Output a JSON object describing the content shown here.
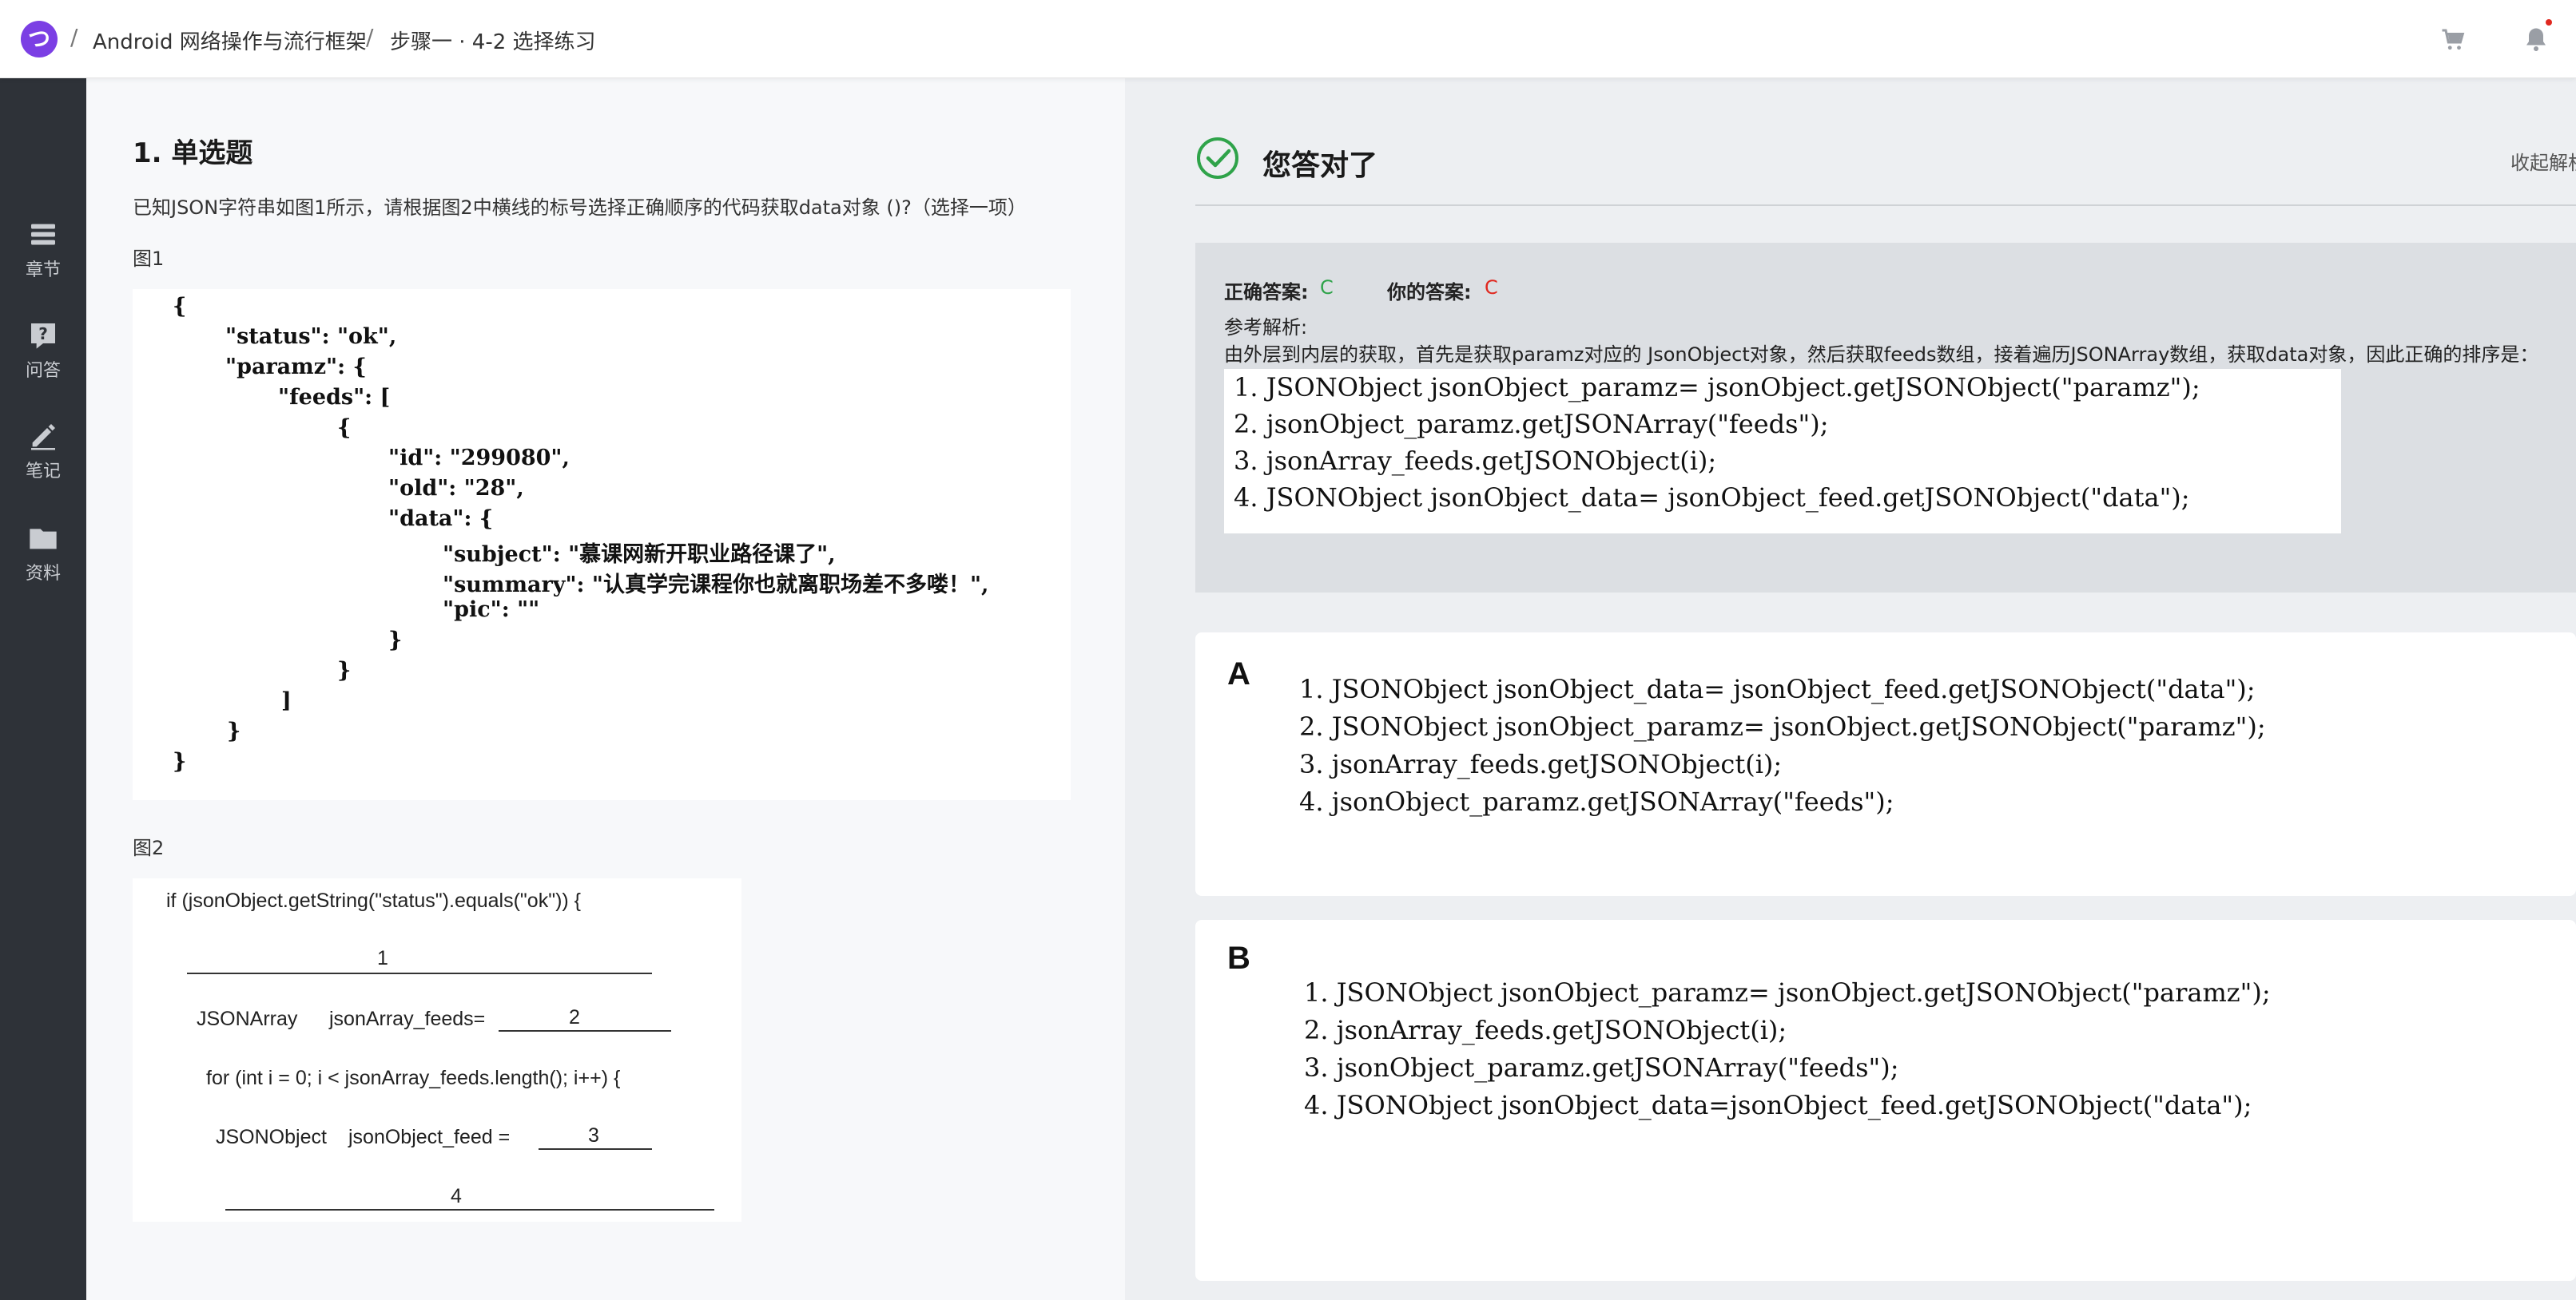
{
  "header": {
    "breadcrumb": [
      "Android 网络操作与流行框架",
      "步骤一 · 4-2 选择练习"
    ],
    "separator": "/"
  },
  "sidebar": {
    "items": [
      {
        "label": "章节",
        "icon": "layers-icon"
      },
      {
        "label": "问答",
        "icon": "question-icon"
      },
      {
        "label": "笔记",
        "icon": "pencil-icon"
      },
      {
        "label": "资料",
        "icon": "folder-icon"
      }
    ]
  },
  "question": {
    "title": "1. 单选题",
    "stem": "已知JSON字符串如图1所示，请根据图2中横线的标号选择正确顺序的代码获取data对象 ()?（选择一项）",
    "fig1_label": "图1",
    "fig2_label": "图2",
    "fig1_json_lines": [
      "{",
      "\"status\": \"ok\",",
      "\"paramz\": {",
      "\"feeds\": [",
      "{",
      "\"id\": \"299080\",",
      "\"old\": \"28\",",
      "\"data\": {",
      "\"subject\": \"慕课网新开职业路径课了\",",
      "\"summary\": \"认真学完课程你也就离职场差不多喽！\",",
      "\"pic\": \"\"",
      "}",
      "}",
      "]",
      "}",
      "}"
    ],
    "fig2_code": {
      "line1": "if (jsonObject.getString(\"status\").equals(\"ok\")) {",
      "blank1": "1",
      "line2a": "JSONArray",
      "line2b": "jsonArray_feeds=",
      "blank2": "2",
      "line3": "for (int i = 0; i < jsonArray_feeds.length(); i++) {",
      "line4a": "JSONObject",
      "line4b": "jsonObject_feed =",
      "blank3": "3",
      "blank4": "4"
    }
  },
  "result": {
    "title": "您答对了",
    "collapse_label": "收起解析",
    "correct_answer_label": "正确答案:",
    "correct_answer": "C",
    "your_answer_label": "你的答案:",
    "your_answer": "C",
    "reference_label": "参考解析:",
    "reference_text": "由外层到内层的获取，首先是获取paramz对应的 JsonObject对象，然后获取feeds数组，接着遍历JSONArray数组，获取data对象，因此正确的排序是：",
    "reference_code": [
      "1.  JSONObject jsonObject_paramz= jsonObject.getJSONObject(\"paramz\");",
      "2.  jsonObject_paramz.getJSONArray(\"feeds\");",
      "3.  jsonArray_feeds.getJSONObject(i);",
      "4.  JSONObject jsonObject_data= jsonObject_feed.getJSONObject(\"data\");"
    ],
    "correct_color": "#2fa34a",
    "wrong_color": "#e0281f"
  },
  "options": [
    {
      "letter": "A",
      "lines": [
        "1.  JSONObject jsonObject_data= jsonObject_feed.getJSONObject(\"data\");",
        "2.  JSONObject jsonObject_paramz= jsonObject.getJSONObject(\"paramz\");",
        "3.  jsonArray_feeds.getJSONObject(i);",
        "4.  jsonObject_paramz.getJSONArray(\"feeds\");"
      ]
    },
    {
      "letter": "B",
      "lines": [
        "1.  JSONObject jsonObject_paramz= jsonObject.getJSONObject(\"paramz\");",
        "2.  jsonArray_feeds.getJSONObject(i);",
        "3.  jsonObject_paramz.getJSONArray(\"feeds\");",
        "4.  JSONObject jsonObject_data=jsonObject_feed.getJSONObject(\"data\");"
      ]
    }
  ]
}
